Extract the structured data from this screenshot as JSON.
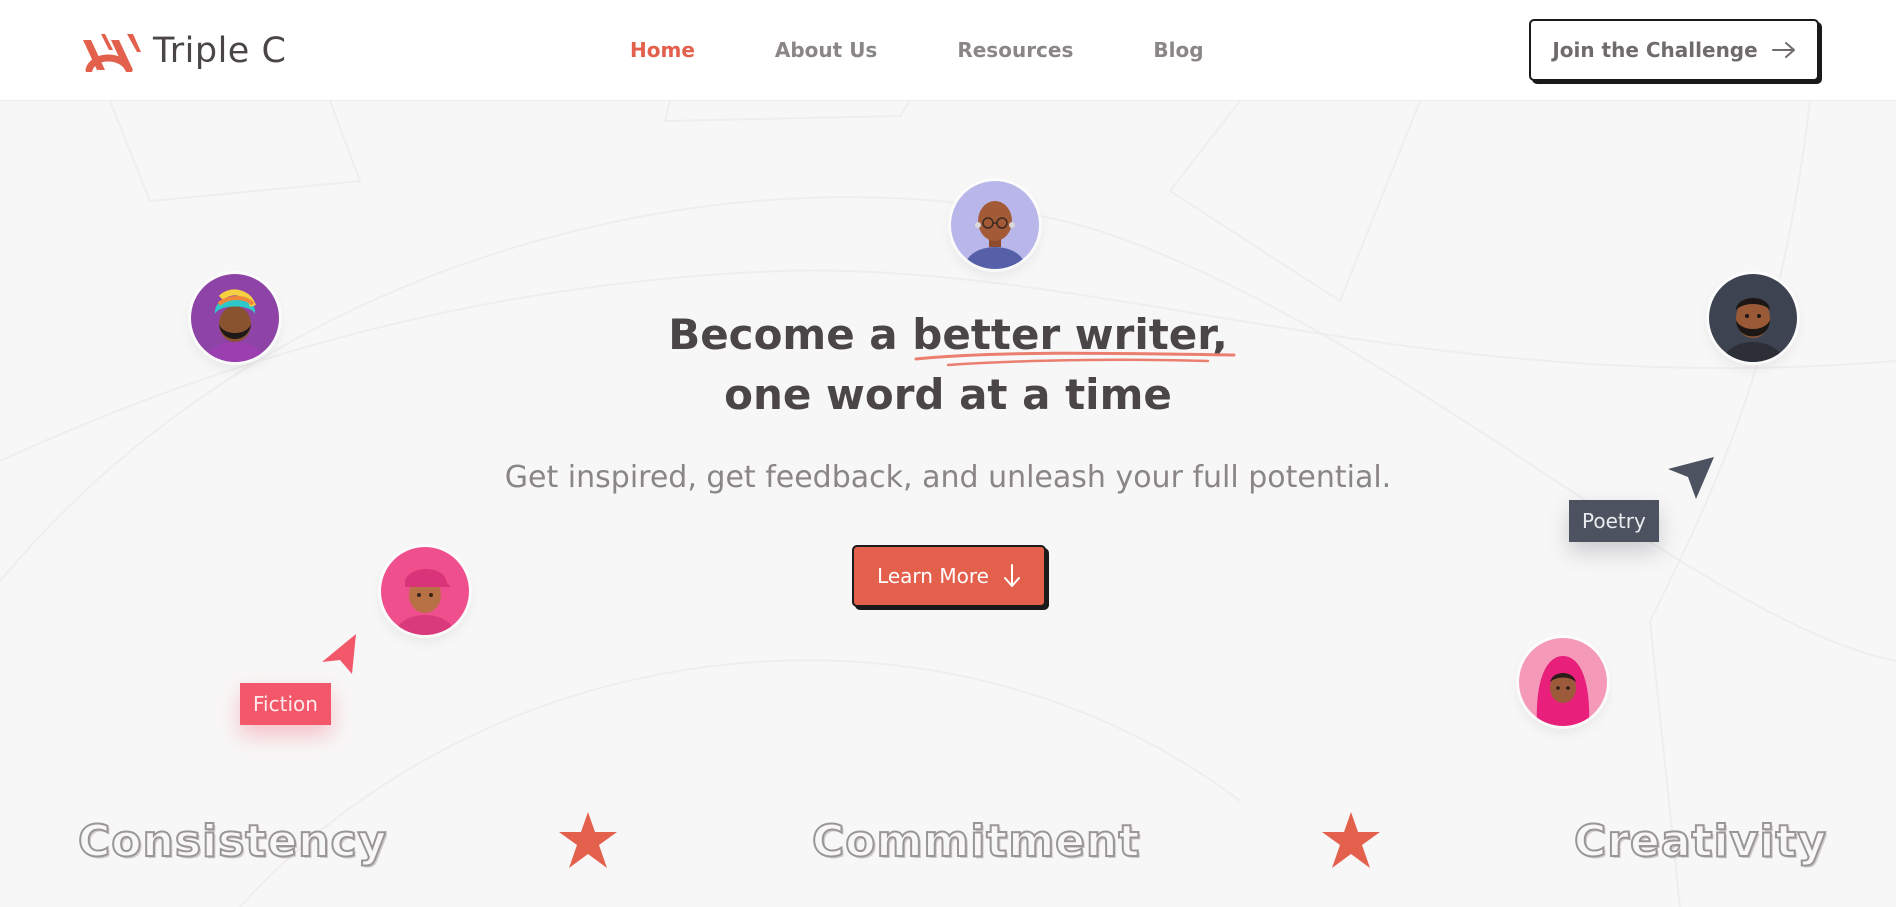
{
  "brand": {
    "name": "Triple C",
    "accent": "#e3604d"
  },
  "nav": {
    "items": [
      {
        "label": "Home",
        "active": true
      },
      {
        "label": "About Us",
        "active": false
      },
      {
        "label": "Resources",
        "active": false
      },
      {
        "label": "Blog",
        "active": false
      }
    ]
  },
  "header": {
    "cta_label": "Join the Challenge",
    "cta_icon": "arrow-right-icon"
  },
  "hero": {
    "headline_line1_prefix": "Become a ",
    "headline_highlight": "better writer",
    "headline_line1_suffix": ",",
    "headline_line2": "one word at a time",
    "subheadline": "Get inspired, get feedback, and unleash your full potential.",
    "button_label": "Learn More",
    "button_icon": "arrow-down-icon"
  },
  "tags": {
    "fiction": {
      "label": "Fiction",
      "color": "#f2586a"
    },
    "poetry": {
      "label": "Poetry",
      "color": "#4c5260"
    }
  },
  "values": {
    "words": [
      "Consistency",
      "Commitment",
      "Creativity"
    ],
    "star_color": "#e3604d"
  },
  "colors": {
    "background": "#f8f7f7",
    "text_dark": "#4a4546",
    "text_muted": "#8a8586"
  }
}
